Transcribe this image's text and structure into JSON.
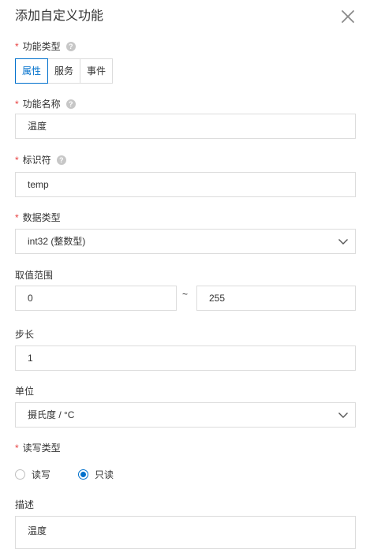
{
  "dialog": {
    "title": "添加自定义功能"
  },
  "function_type": {
    "label": "功能类型",
    "required": "*",
    "options": [
      "属性",
      "服务",
      "事件"
    ],
    "selected": "属性"
  },
  "function_name": {
    "label": "功能名称",
    "required": "*",
    "value": "温度"
  },
  "identifier": {
    "label": "标识符",
    "required": "*",
    "value": "temp"
  },
  "data_type": {
    "label": "数据类型",
    "required": "*",
    "value": "int32 (整数型)"
  },
  "value_range": {
    "label": "取值范围",
    "min": "0",
    "separator": "~",
    "max": "255"
  },
  "step": {
    "label": "步长",
    "value": "1"
  },
  "unit": {
    "label": "单位",
    "value": "摄氏度 / °C"
  },
  "rw_type": {
    "label": "读写类型",
    "required": "*",
    "options": [
      "读写",
      "只读"
    ],
    "selected": "只读"
  },
  "description": {
    "label": "描述",
    "value": "温度"
  },
  "icons": {
    "help": "?",
    "close": "close-icon",
    "chevron": "chevron-down-icon"
  },
  "colors": {
    "accent": "#0070cc",
    "required": "#e84141",
    "border": "#dcdcdc",
    "text": "#333333"
  }
}
